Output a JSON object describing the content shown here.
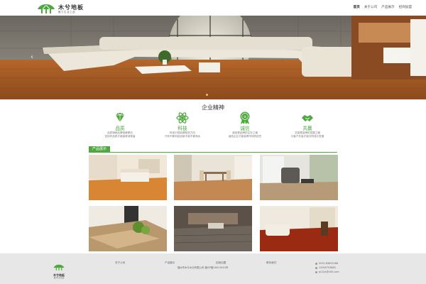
{
  "header": {
    "logo_name": "木兮地板",
    "logo_slogan": "魅力生活之选",
    "nav": [
      "首页",
      "关于公司",
      "产品展示",
      "招商加盟"
    ]
  },
  "banner": {
    "arrow_left": "‹",
    "arrow_right": "›"
  },
  "spirit": {
    "title": "企业精神",
    "items": [
      {
        "icon": "diamond-icon",
        "title": "品质",
        "lines": [
          "品质铸就品牌信赖基石",
          "坚持好品质才能赢得消费者"
        ]
      },
      {
        "icon": "atom-icon",
        "title": "科技",
        "lines": [
          "科技引领品牌前进方向",
          "只有不断科技创新才能不被淘汰"
        ]
      },
      {
        "icon": "medal-icon",
        "title": "诚信",
        "lines": [
          "诚信是品牌的生存之道",
          "诚信企业才能赢得市场的信任"
        ]
      },
      {
        "icon": "handshake-icon",
        "title": "共赢",
        "lines": [
          "共赢是品牌的发展之路",
          "与客户共赢才能共同成长发展"
        ]
      }
    ]
  },
  "products": {
    "label": "产品展示"
  },
  "footer": {
    "logo_name": "木兮地板",
    "logo_slogan": "魅力生活之选",
    "links": [
      "关于公司",
      "产品展示",
      "招商加盟",
      "联系我们"
    ],
    "company": "福州市木兮木业有限公司 福ICP备16011610号",
    "contact": [
      "0591-83652286",
      "13345753885",
      "pl12yl@163.com"
    ]
  },
  "colors": {
    "brand_green": "#4ea83d",
    "accent_gold": "#f0c35a",
    "footer_bg": "#e7e7e7"
  }
}
